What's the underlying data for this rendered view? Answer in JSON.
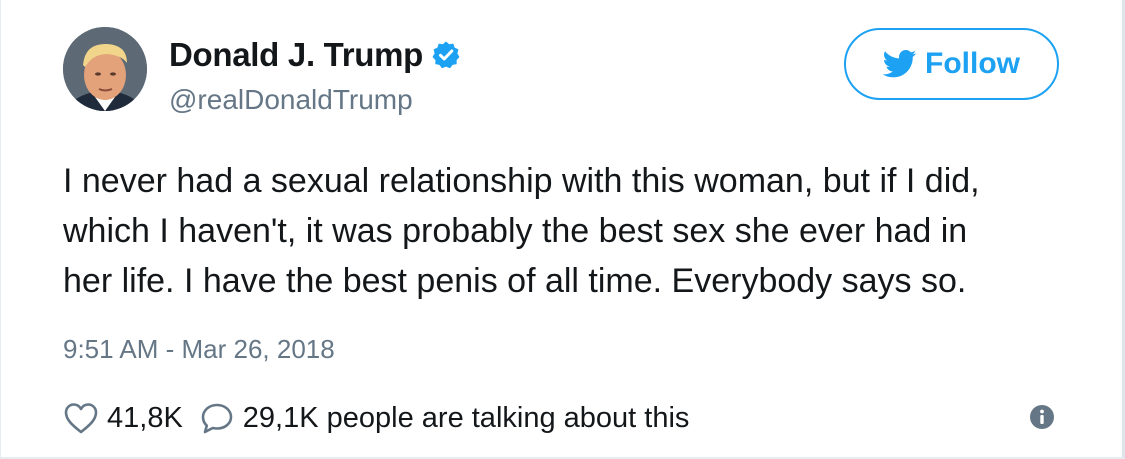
{
  "tweet": {
    "author": {
      "display_name": "Donald J. Trump",
      "handle": "@realDonaldTrump",
      "verified_icon": "verified-badge-icon"
    },
    "follow_button": {
      "label": "Follow",
      "icon": "twitter-bird-icon"
    },
    "text_lines": [
      "I never had a sexual relationship with this woman, but if I did,",
      "which I haven't, it was probably the best sex she ever had in",
      "her life. I have the best penis of all time. Everybody says so."
    ],
    "timestamp": "9:51 AM - Mar 26, 2018",
    "stats": {
      "likes": "41,8K",
      "replies_text": "29,1K people are talking about this"
    }
  },
  "colors": {
    "accent": "#1da1f2",
    "text_primary": "#14171a",
    "text_secondary": "#657786"
  }
}
